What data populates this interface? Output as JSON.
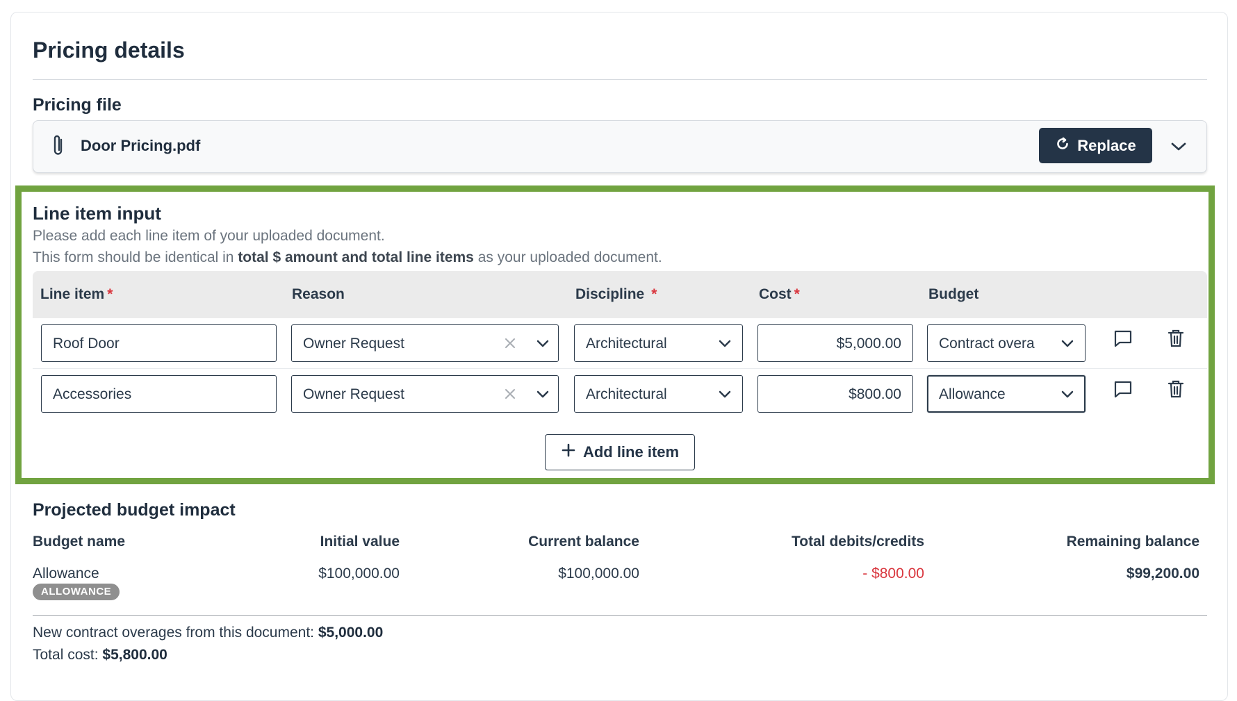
{
  "pricing": {
    "title": "Pricing details",
    "file_label": "Pricing file",
    "file_name": "Door Pricing.pdf",
    "replace_label": "Replace"
  },
  "line_items": {
    "title": "Line item input",
    "desc1": "Please add each line item of your uploaded document.",
    "desc2_pre": "This form should be identical in ",
    "desc2_bold": "total $ amount and total line items",
    "desc2_post": " as your uploaded document.",
    "columns": {
      "line_item": "Line item",
      "reason": "Reason",
      "discipline": "Discipline",
      "cost": "Cost",
      "budget": "Budget",
      "required_mark": "*"
    },
    "rows": [
      {
        "line_item": "Roof Door",
        "reason": "Owner Request",
        "discipline": "Architectural",
        "cost": "$5,000.00",
        "budget": "Contract overa"
      },
      {
        "line_item": "Accessories",
        "reason": "Owner Request",
        "discipline": "Architectural",
        "cost": "$800.00",
        "budget": "Allowance"
      }
    ],
    "add_label": "Add line item"
  },
  "budget_impact": {
    "title": "Projected budget impact",
    "headers": {
      "name": "Budget name",
      "initial": "Initial value",
      "current": "Current balance",
      "debits": "Total debits/credits",
      "remaining": "Remaining balance"
    },
    "row": {
      "name": "Allowance",
      "badge": "ALLOWANCE",
      "initial": "$100,000.00",
      "current": "$100,000.00",
      "debits": "- $800.00",
      "remaining": "$99,200.00"
    },
    "summary": {
      "overages_label": "New contract overages from this document: ",
      "overages_value": "$5,000.00",
      "total_label": "Total cost: ",
      "total_value": "$5,800.00"
    }
  },
  "colors": {
    "highlight_frame": "#71a340",
    "primary_button": "#243447",
    "required": "#d9363e",
    "badge": "#8f8f8f"
  },
  "icons": [
    "paperclip-icon",
    "refresh-icon",
    "chevron-down-icon",
    "close-icon",
    "comment-icon",
    "trash-icon",
    "plus-icon"
  ]
}
